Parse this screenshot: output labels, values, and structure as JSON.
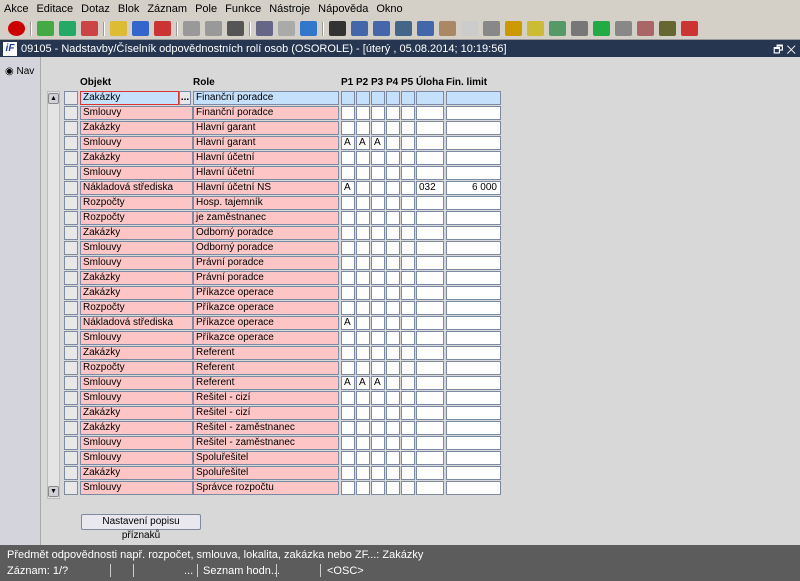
{
  "menu": [
    "Akce",
    "Editace",
    "Dotaz",
    "Blok",
    "Záznam",
    "Pole",
    "Funkce",
    "Nástroje",
    "Nápověda",
    "Okno"
  ],
  "toolbar_icons": [
    "exit-icon",
    "insert-record-icon",
    "save-icon",
    "delete-record-icon",
    "query-yellow-icon",
    "query-blue-icon",
    "query-red-icon",
    "sort-asc-icon",
    "sort-desc-icon",
    "filter-icon",
    "print-icon",
    "printer-settings-icon",
    "mail-icon",
    "cut-icon",
    "copy-icon",
    "paste-icon",
    "find-icon",
    "list-icon",
    "calc-icon",
    "doc-icon",
    "globe-icon",
    "tools-icon",
    "warning-icon",
    "calendar-icon",
    "help-about-icon",
    "excel-icon",
    "clock-icon",
    "user-icon",
    "help-icon",
    "context-help-icon"
  ],
  "title": "09105 - Nadstavby/Číselník odpovědnostních rolí osob (OSOROLE) - [úterý  , 05.08.2014; 10:19:56]",
  "nav_label": "Nav",
  "columns": {
    "objekt": "Objekt",
    "role": "Role",
    "p1": "P1",
    "p2": "P2",
    "p3": "P3",
    "p4": "P4",
    "p5": "P5",
    "uloha": "Úloha",
    "limit": "Fin. limit"
  },
  "rows": [
    {
      "objekt": "Zakázky",
      "role": "Finanční poradce",
      "p": [
        "",
        "",
        "",
        "",
        ""
      ],
      "uloha": "",
      "limit": ""
    },
    {
      "objekt": "Smlouvy",
      "role": "Finanční poradce",
      "p": [
        "",
        "",
        "",
        "",
        ""
      ],
      "uloha": "",
      "limit": ""
    },
    {
      "objekt": "Zakázky",
      "role": "Hlavní garant",
      "p": [
        "",
        "",
        "",
        "",
        ""
      ],
      "uloha": "",
      "limit": ""
    },
    {
      "objekt": "Smlouvy",
      "role": "Hlavní garant",
      "p": [
        "A",
        "A",
        "A",
        "",
        ""
      ],
      "uloha": "",
      "limit": ""
    },
    {
      "objekt": "Zakázky",
      "role": "Hlavní účetní",
      "p": [
        "",
        "",
        "",
        "",
        ""
      ],
      "uloha": "",
      "limit": ""
    },
    {
      "objekt": "Smlouvy",
      "role": "Hlavní účetní",
      "p": [
        "",
        "",
        "",
        "",
        ""
      ],
      "uloha": "",
      "limit": ""
    },
    {
      "objekt": "Nákladová střediska",
      "role": "Hlavní účetní NS",
      "p": [
        "A",
        "",
        "",
        "",
        ""
      ],
      "uloha": "032",
      "limit": "6 000"
    },
    {
      "objekt": "Rozpočty",
      "role": "Hosp. tajemník",
      "p": [
        "",
        "",
        "",
        "",
        ""
      ],
      "uloha": "",
      "limit": ""
    },
    {
      "objekt": "Rozpočty",
      "role": "je zaměstnanec",
      "p": [
        "",
        "",
        "",
        "",
        ""
      ],
      "uloha": "",
      "limit": ""
    },
    {
      "objekt": "Zakázky",
      "role": "Odborný poradce",
      "p": [
        "",
        "",
        "",
        "",
        ""
      ],
      "uloha": "",
      "limit": ""
    },
    {
      "objekt": "Smlouvy",
      "role": "Odborný poradce",
      "p": [
        "",
        "",
        "",
        "",
        ""
      ],
      "uloha": "",
      "limit": ""
    },
    {
      "objekt": "Smlouvy",
      "role": "Právní poradce",
      "p": [
        "",
        "",
        "",
        "",
        ""
      ],
      "uloha": "",
      "limit": ""
    },
    {
      "objekt": "Zakázky",
      "role": "Právní poradce",
      "p": [
        "",
        "",
        "",
        "",
        ""
      ],
      "uloha": "",
      "limit": ""
    },
    {
      "objekt": "Zakázky",
      "role": "Příkazce operace",
      "p": [
        "",
        "",
        "",
        "",
        ""
      ],
      "uloha": "",
      "limit": ""
    },
    {
      "objekt": "Rozpočty",
      "role": "Příkazce operace",
      "p": [
        "",
        "",
        "",
        "",
        ""
      ],
      "uloha": "",
      "limit": ""
    },
    {
      "objekt": "Nákladová střediska",
      "role": "Příkazce operace",
      "p": [
        "A",
        "",
        "",
        "",
        ""
      ],
      "uloha": "",
      "limit": ""
    },
    {
      "objekt": "Smlouvy",
      "role": "Příkazce operace",
      "p": [
        "",
        "",
        "",
        "",
        ""
      ],
      "uloha": "",
      "limit": ""
    },
    {
      "objekt": "Zakázky",
      "role": "Referent",
      "p": [
        "",
        "",
        "",
        "",
        ""
      ],
      "uloha": "",
      "limit": ""
    },
    {
      "objekt": "Rozpočty",
      "role": "Referent",
      "p": [
        "",
        "",
        "",
        "",
        ""
      ],
      "uloha": "",
      "limit": ""
    },
    {
      "objekt": "Smlouvy",
      "role": "Referent",
      "p": [
        "A",
        "A",
        "A",
        "",
        ""
      ],
      "uloha": "",
      "limit": ""
    },
    {
      "objekt": "Smlouvy",
      "role": "Řešitel - cizí",
      "p": [
        "",
        "",
        "",
        "",
        ""
      ],
      "uloha": "",
      "limit": ""
    },
    {
      "objekt": "Zakázky",
      "role": "Řešitel - cizí",
      "p": [
        "",
        "",
        "",
        "",
        ""
      ],
      "uloha": "",
      "limit": ""
    },
    {
      "objekt": "Zakázky",
      "role": "Řešitel - zaměstnanec",
      "p": [
        "",
        "",
        "",
        "",
        ""
      ],
      "uloha": "",
      "limit": ""
    },
    {
      "objekt": "Smlouvy",
      "role": "Řešitel - zaměstnanec",
      "p": [
        "",
        "",
        "",
        "",
        ""
      ],
      "uloha": "",
      "limit": ""
    },
    {
      "objekt": "Smlouvy",
      "role": "Spoluřešitel",
      "p": [
        "",
        "",
        "",
        "",
        ""
      ],
      "uloha": "",
      "limit": ""
    },
    {
      "objekt": "Zakázky",
      "role": "Spoluřešitel",
      "p": [
        "",
        "",
        "",
        "",
        ""
      ],
      "uloha": "",
      "limit": ""
    },
    {
      "objekt": "Smlouvy",
      "role": "Správce rozpočtu",
      "p": [
        "",
        "",
        "",
        "",
        ""
      ],
      "uloha": "",
      "limit": ""
    }
  ],
  "lov_button": "...",
  "flags_button": "Nastavení popisu příznaků",
  "status": {
    "hint": "Předmět odpovědnosti např. rozpočet, smlouva, lokalita, zakázka nebo ZF...: Zakázky",
    "record": "Záznam: 1/?",
    "ellipsis": "...",
    "lov": "Seznam hodn...",
    "mode": "<OSC>"
  },
  "colors": {
    "title_bar": "#263650",
    "row_pink": "#fdc5c5",
    "row_current": "#c5e0fb",
    "border": "#7d8aa3"
  }
}
